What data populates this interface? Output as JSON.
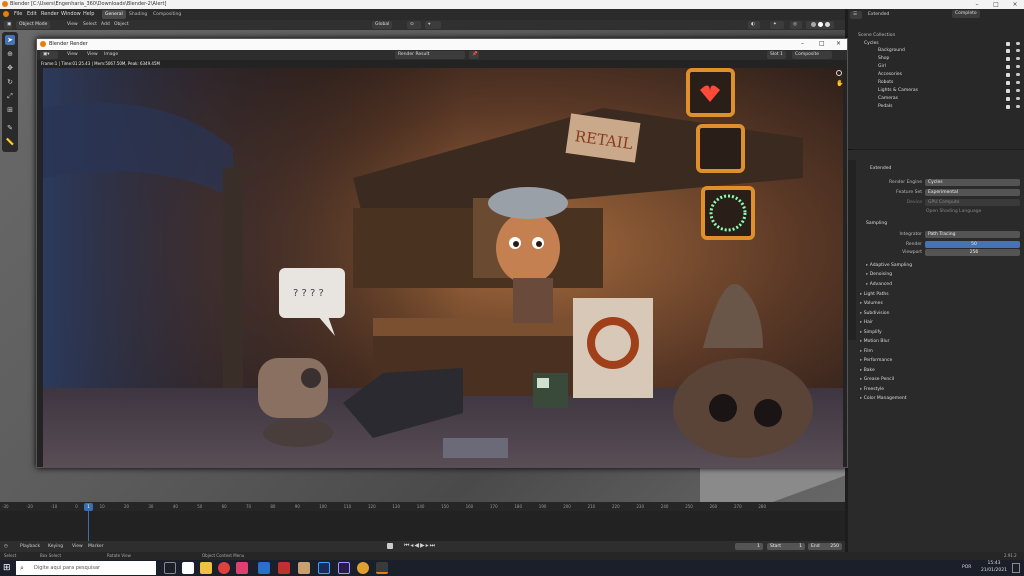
{
  "app": {
    "title": "Blender [C:\\Users\\Engenharia_360\\Downloads\\Blender-2\\Alert]",
    "menus": [
      "File",
      "Edit",
      "Render",
      "Window",
      "Help"
    ],
    "workspaces": [
      "General",
      "Shading",
      "Compositing"
    ],
    "active_workspace": "General"
  },
  "viewport_header": {
    "mode": "Object Mode",
    "items": [
      "View",
      "Select",
      "Add",
      "Object"
    ],
    "orientation": "Global"
  },
  "render_window": {
    "title": "Blender Render",
    "menus": [
      "View",
      "View",
      "Image"
    ],
    "slot_label": "Render Result",
    "slot": "Slot 1",
    "layer": "Composite",
    "info": "Frame:1 | Time:01:25.43 | Mem:5067.50M, Peak: 6349.45M",
    "scene_labels": {
      "sign": "RETAIL",
      "speech": "? ? ? ?"
    }
  },
  "timeline": {
    "ticks": [
      "-30",
      "-20",
      "-10",
      "0",
      "10",
      "20",
      "30",
      "40",
      "50",
      "60",
      "70",
      "80",
      "90",
      "100",
      "110",
      "120",
      "130",
      "140",
      "150",
      "160",
      "170",
      "180",
      "190",
      "200",
      "210",
      "220",
      "230",
      "240",
      "250",
      "260",
      "270",
      "280"
    ],
    "current_frame": "1",
    "controls": [
      "Playback",
      "Keying",
      "View",
      "Marker"
    ],
    "frame_field": "1",
    "start_label": "Start",
    "start": "1",
    "end_label": "End",
    "end": "250"
  },
  "statusbar": {
    "items": [
      "Select",
      "Box Select",
      "Rotate View",
      "Object Context Menu"
    ],
    "version": "2.91.2"
  },
  "outliner": {
    "header_field": "Extended",
    "view_layer": "Completo",
    "root": "Scene Collection",
    "items": [
      "Cycles",
      "Background",
      "Shop",
      "Girl",
      "Accesories",
      "Robots",
      "Lights & Cameras",
      "Cameras",
      "Pedals"
    ]
  },
  "properties": {
    "header": "Extended",
    "render_engine_label": "Render Engine",
    "render_engine": "Cycles",
    "feature_set_label": "Feature Set",
    "feature_set": "Experimental",
    "device_label": "Device",
    "device": "GPU Compute",
    "osl": "Open Shading Language",
    "sampling": "Sampling",
    "integrator_label": "Integrator",
    "integrator": "Path Tracing",
    "render_label": "Render",
    "render_samples": "50",
    "viewport_label": "Viewport",
    "viewport_samples": "256",
    "sub_sections": [
      "Adaptive Sampling",
      "Denoising",
      "Advanced"
    ],
    "sections": [
      "Light Paths",
      "Volumes",
      "Subdivision",
      "Hair",
      "Simplify",
      "Motion Blur",
      "Film",
      "Performance",
      "Bake",
      "Grease Pencil",
      "Freestyle",
      "Color Management"
    ]
  },
  "taskbar": {
    "search_placeholder": "Digite aqui para pesquisar",
    "time": "15:43",
    "date": "21/01/2021",
    "lang": "POR"
  },
  "colors": {
    "accent": "#4772b3",
    "frame_marker": "#3a6fb0"
  }
}
